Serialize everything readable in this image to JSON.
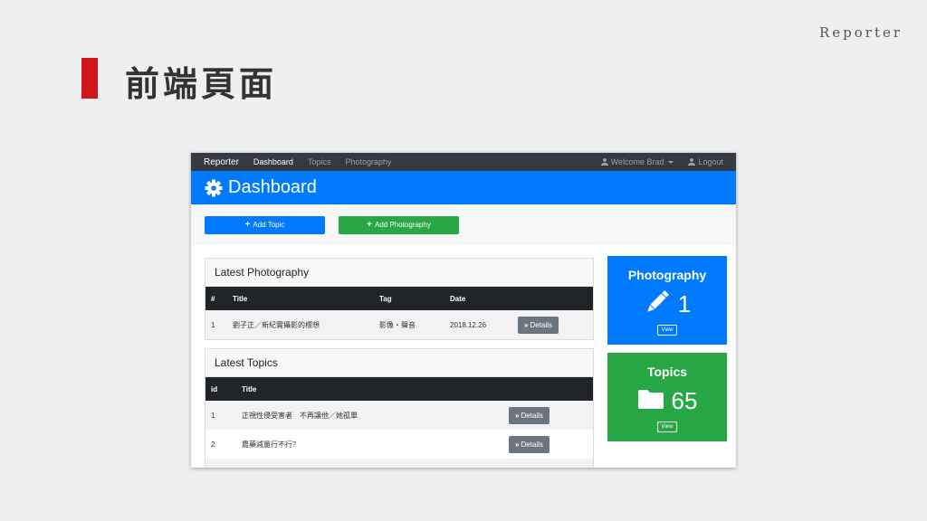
{
  "slide": {
    "brand": "Reporter",
    "title": "前端頁面"
  },
  "app": {
    "navbar": {
      "brand": "Reporter",
      "links": [
        "Dashboard",
        "Topics",
        "Photography"
      ],
      "active": "Dashboard",
      "user_menu": "Welcome Brad",
      "logout": "Logout"
    },
    "header": {
      "title": "Dashboard"
    },
    "actions": {
      "add_topic": "Add Topic",
      "add_photography": "Add Photography"
    },
    "latest_photography": {
      "title": "Latest Photography",
      "columns": [
        "#",
        "Title",
        "Tag",
        "Date"
      ],
      "rows": [
        {
          "num": "1",
          "title": "劉子正／新紀實攝影的標想",
          "tag": "影像・聲音",
          "date": "2018.12.26",
          "action": "Details"
        }
      ]
    },
    "latest_topics": {
      "title": "Latest Topics",
      "columns": [
        "id",
        "Title"
      ],
      "rows": [
        {
          "id": "1",
          "title": "正視性侵受害者　不再讓他／她孤單",
          "action": "Details"
        },
        {
          "id": "2",
          "title": "農藥減量行不行？",
          "action": "Details"
        }
      ]
    },
    "stats": {
      "photography": {
        "title": "Photography",
        "count": "1",
        "view": "View",
        "icon": "pencil-icon"
      },
      "topics": {
        "title": "Topics",
        "count": "65",
        "view": "View",
        "icon": "folder-icon"
      }
    },
    "colors": {
      "primary": "#007bff",
      "success": "#28a745",
      "dark": "#343a40",
      "secondary": "#6c757d",
      "slide_accent": "#d0141b"
    }
  }
}
